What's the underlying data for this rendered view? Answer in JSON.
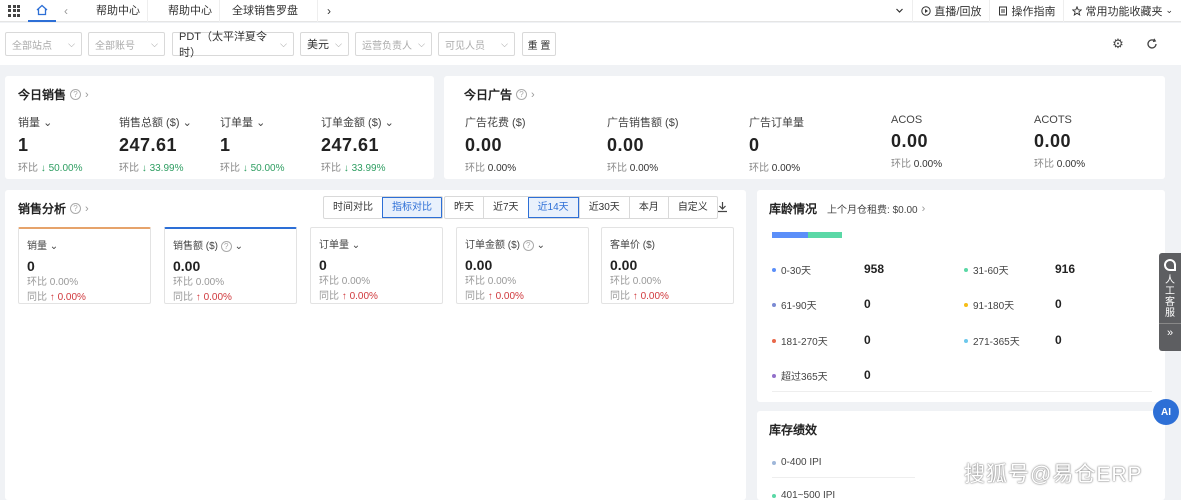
{
  "tabbar": {
    "tabs": [
      "帮助中心",
      "帮助中心",
      "全球销售罗盘"
    ],
    "right_items": [
      "直播/回放",
      "操作指南",
      "常用功能收藏夹"
    ]
  },
  "filters": {
    "site": "全部站点",
    "account": "全部账号",
    "timezone": "PDT（太平洋夏令时）",
    "currency": "美元",
    "ops_owner": "运营负责人",
    "visible_users": "可见人员",
    "reset": "重 置"
  },
  "today_sales": {
    "title": "今日销售",
    "metrics": [
      {
        "label": "销量",
        "value": "1",
        "ratio_label": "环比",
        "ratio": "50.00%"
      },
      {
        "label": "销售总额 ($)",
        "value": "247.61",
        "ratio_label": "环比",
        "ratio": "33.99%"
      },
      {
        "label": "订单量",
        "value": "1",
        "ratio_label": "环比",
        "ratio": "50.00%"
      },
      {
        "label": "订单金额 ($)",
        "value": "247.61",
        "ratio_label": "环比",
        "ratio": "33.99%"
      }
    ]
  },
  "today_ads": {
    "title": "今日广告",
    "metrics": [
      {
        "label": "广告花费 ($)",
        "value": "0.00",
        "ratio_label": "环比",
        "ratio": "0.00%"
      },
      {
        "label": "广告销售额 ($)",
        "value": "0.00",
        "ratio_label": "环比",
        "ratio": "0.00%"
      },
      {
        "label": "广告订单量",
        "value": "0",
        "ratio_label": "环比",
        "ratio": "0.00%"
      },
      {
        "label": "ACOS",
        "value": "0.00",
        "ratio_label": "环比",
        "ratio": "0.00%"
      },
      {
        "label": "ACOTS",
        "value": "0.00",
        "ratio_label": "环比",
        "ratio": "0.00%"
      }
    ]
  },
  "sales_analysis": {
    "title": "销售分析",
    "compare_tabs": [
      "时间对比",
      "指标对比"
    ],
    "range_tabs": [
      "昨天",
      "近7天",
      "近14天",
      "近30天",
      "本月",
      "自定义"
    ],
    "cards": [
      {
        "label": "销量",
        "value": "0",
        "hb": "环比 0.00%",
        "tb_label": "同比",
        "tb": "0.00%"
      },
      {
        "label": "销售额 ($)",
        "value": "0.00",
        "hb": "环比 0.00%",
        "tb_label": "同比",
        "tb": "0.00%"
      },
      {
        "label": "订单量",
        "value": "0",
        "hb": "环比 0.00%",
        "tb_label": "同比",
        "tb": "0.00%"
      },
      {
        "label": "订单金额 ($)",
        "value": "0.00",
        "hb": "环比 0.00%",
        "tb_label": "同比",
        "tb": "0.00%"
      },
      {
        "label": "客单价 ($)",
        "value": "0.00",
        "hb": "环比 0.00%",
        "tb_label": "同比",
        "tb": "0.00%"
      }
    ]
  },
  "inventory_age": {
    "title": "库龄情况",
    "subtitle": "上个月仓租费: $0.00",
    "items": [
      {
        "label": "0-30天",
        "value": "958",
        "color": "#5b8ff9"
      },
      {
        "label": "31-60天",
        "value": "916",
        "color": "#5ad8a6"
      },
      {
        "label": "61-90天",
        "value": "0",
        "color": "#7b8ad3"
      },
      {
        "label": "91-180天",
        "value": "0",
        "color": "#f6bd16"
      },
      {
        "label": "181-270天",
        "value": "0",
        "color": "#e8684a"
      },
      {
        "label": "271-365天",
        "value": "0",
        "color": "#6dc8ec"
      },
      {
        "label": "超过365天",
        "value": "0",
        "color": "#9270ca"
      }
    ],
    "bar_share": [
      0.51,
      0.49
    ]
  },
  "inventory_perf": {
    "title": "库存绩效",
    "items": [
      "0-400 IPI",
      "401~500 IPI"
    ]
  },
  "side": {
    "cs_text": "人工客服",
    "ai": "AI"
  },
  "watermark": "搜狐号@易仓ERP"
}
